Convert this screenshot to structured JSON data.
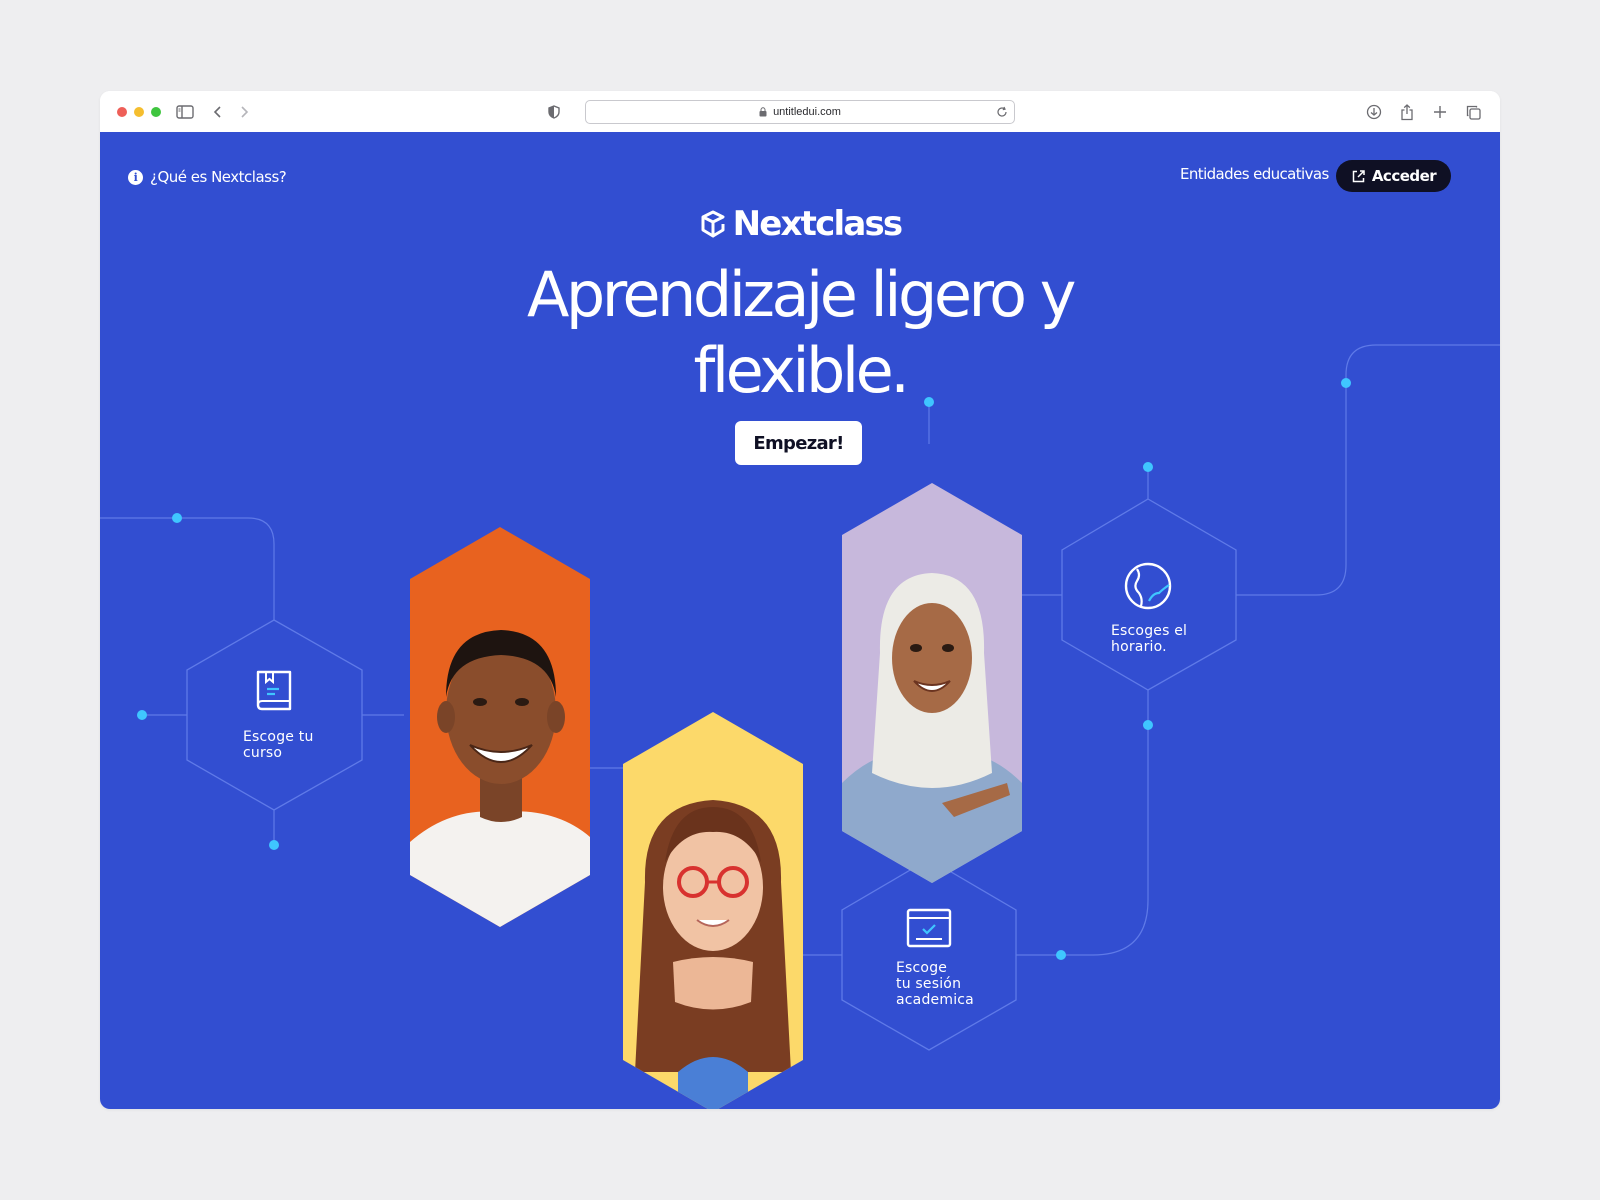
{
  "browser": {
    "url": "untitledui.com",
    "traffic_lights": [
      "#ee5f58",
      "#f5be2f",
      "#3fc53f"
    ]
  },
  "nav": {
    "info_link": "¿Qué es Nextclass?",
    "entities_link": "Entidades educativas",
    "login_button": "Acceder"
  },
  "hero": {
    "logo_text": "Nextclass",
    "headline_line1": "Aprendizaje ligero y",
    "headline_line2": "flexible.",
    "cta": "Empezar!"
  },
  "steps": [
    {
      "icon": "book-icon",
      "label_line1": "Escoge tu",
      "label_line2": "curso",
      "label_line3": ""
    },
    {
      "icon": "globe-icon",
      "label_line1": "Escoges el",
      "label_line2": "horario.",
      "label_line3": ""
    },
    {
      "icon": "calendar-check-icon",
      "label_line1": "Escoge",
      "label_line2": "tu sesión",
      "label_line3": "academica"
    }
  ],
  "photos": [
    {
      "name": "smiling-man-photo",
      "background": "#e8621f"
    },
    {
      "name": "smiling-woman-glasses-photo",
      "background": "#fcd96a"
    },
    {
      "name": "woman-hijab-photo",
      "background": "#c7b8dc"
    }
  ],
  "colors": {
    "hero_bg": "#324ed1",
    "accent_dot": "#3fc6ff",
    "line": "#5f7ae8",
    "cta_bg": "#ffffff",
    "login_bg": "#0f1024"
  }
}
